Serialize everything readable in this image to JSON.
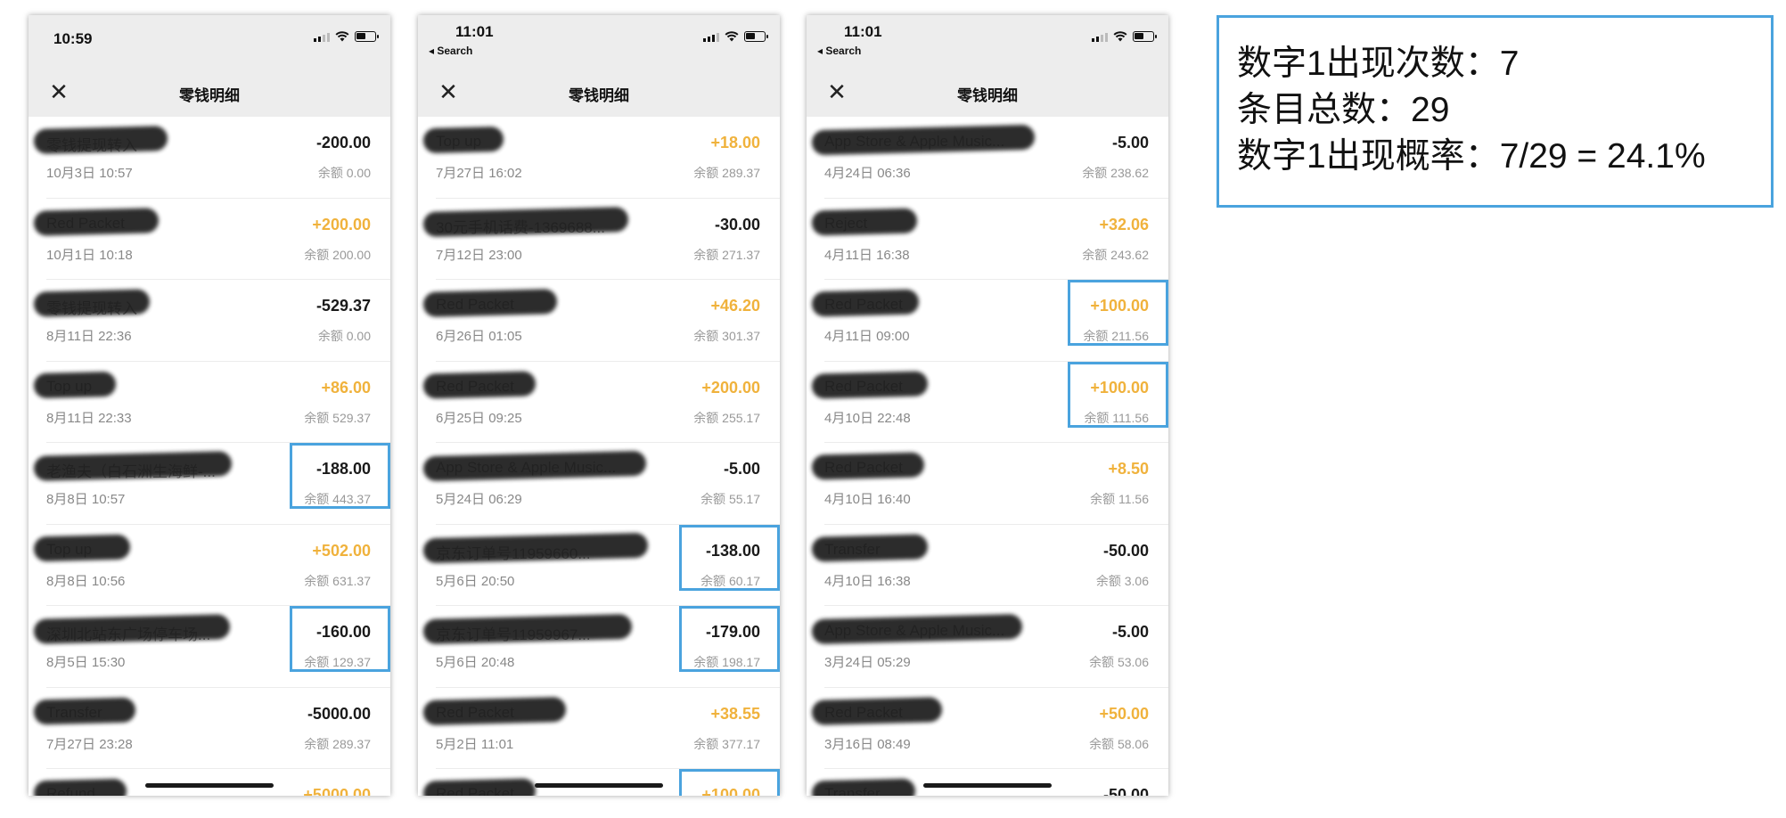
{
  "phones": [
    {
      "time": "10:59",
      "back_label": "",
      "title": "零钱明细",
      "rows": [
        {
          "title": "零钱提现转入",
          "date": "10月3日 10:57",
          "amount": "-200.00",
          "positive": false,
          "balance": "余额 0.00",
          "highlight": false
        },
        {
          "title": "Red Packet",
          "date": "10月1日 10:18",
          "amount": "+200.00",
          "positive": true,
          "balance": "余额 200.00",
          "highlight": false
        },
        {
          "title": "零钱提现转入",
          "date": "8月11日 22:36",
          "amount": "-529.37",
          "positive": false,
          "balance": "余额 0.00",
          "highlight": false
        },
        {
          "title": "Top up",
          "date": "8月11日 22:33",
          "amount": "+86.00",
          "positive": true,
          "balance": "余额 529.37",
          "highlight": false
        },
        {
          "title": "老渔夫（白石洲生海鲜-...",
          "date": "8月8日 10:57",
          "amount": "-188.00",
          "positive": false,
          "balance": "余额 443.37",
          "highlight": true
        },
        {
          "title": "Top up",
          "date": "8月8日 10:56",
          "amount": "+502.00",
          "positive": true,
          "balance": "余额 631.37",
          "highlight": false
        },
        {
          "title": "深圳北站东广场停车场...",
          "date": "8月5日 15:30",
          "amount": "-160.00",
          "positive": false,
          "balance": "余额 129.37",
          "highlight": true
        },
        {
          "title": "Transfer",
          "date": "7月27日 23:28",
          "amount": "-5000.00",
          "positive": false,
          "balance": "余额 289.37",
          "highlight": false
        },
        {
          "title": "Refund",
          "date": "",
          "amount": "+5000.00",
          "positive": true,
          "balance": "",
          "highlight": false
        }
      ]
    },
    {
      "time": "11:01",
      "back_label": "◂ Search",
      "title": "零钱明细",
      "rows": [
        {
          "title": "Top up",
          "date": "7月27日 16:02",
          "amount": "+18.00",
          "positive": true,
          "balance": "余额 289.37",
          "highlight": false
        },
        {
          "title": "30元手机话费-1369688...",
          "date": "7月12日 23:00",
          "amount": "-30.00",
          "positive": false,
          "balance": "余额 271.37",
          "highlight": false
        },
        {
          "title": "Red Packet",
          "date": "6月26日 01:05",
          "amount": "+46.20",
          "positive": true,
          "balance": "余额 301.37",
          "highlight": false
        },
        {
          "title": "Red Packet",
          "date": "6月25日 09:25",
          "amount": "+200.00",
          "positive": true,
          "balance": "余额 255.17",
          "highlight": false
        },
        {
          "title": "App Store & Apple Music...",
          "date": "5月24日 06:29",
          "amount": "-5.00",
          "positive": false,
          "balance": "余额 55.17",
          "highlight": false
        },
        {
          "title": "京东订单号11959660...",
          "date": "5月6日 20:50",
          "amount": "-138.00",
          "positive": false,
          "balance": "余额 60.17",
          "highlight": true
        },
        {
          "title": "京东订单号11959967...",
          "date": "5月6日 20:48",
          "amount": "-179.00",
          "positive": false,
          "balance": "余额 198.17",
          "highlight": true
        },
        {
          "title": "Red Packet",
          "date": "5月2日 11:01",
          "amount": "+38.55",
          "positive": true,
          "balance": "余额 377.17",
          "highlight": false
        },
        {
          "title": "Red Packet",
          "date": "",
          "amount": "+100.00",
          "positive": true,
          "balance": "",
          "highlight": true
        }
      ]
    },
    {
      "time": "11:01",
      "back_label": "◂ Search",
      "title": "零钱明细",
      "rows": [
        {
          "title": "App Store & Apple Music...",
          "date": "4月24日 06:36",
          "amount": "-5.00",
          "positive": false,
          "balance": "余额 238.62",
          "highlight": false
        },
        {
          "title": "Reject",
          "date": "4月11日 16:38",
          "amount": "+32.06",
          "positive": true,
          "balance": "余额 243.62",
          "highlight": false
        },
        {
          "title": "Red Packet",
          "date": "4月11日 09:00",
          "amount": "+100.00",
          "positive": true,
          "balance": "余额 211.56",
          "highlight": true
        },
        {
          "title": "Red Packet",
          "date": "4月10日 22:48",
          "amount": "+100.00",
          "positive": true,
          "balance": "余额 111.56",
          "highlight": true
        },
        {
          "title": "Red Packet",
          "date": "4月10日 16:40",
          "amount": "+8.50",
          "positive": true,
          "balance": "余额 11.56",
          "highlight": false
        },
        {
          "title": "Transfer",
          "date": "4月10日 16:38",
          "amount": "-50.00",
          "positive": false,
          "balance": "余额 3.06",
          "highlight": false
        },
        {
          "title": "App Store & Apple Music...",
          "date": "3月24日 05:29",
          "amount": "-5.00",
          "positive": false,
          "balance": "余额 53.06",
          "highlight": false
        },
        {
          "title": "Red Packet",
          "date": "3月16日 08:49",
          "amount": "+50.00",
          "positive": true,
          "balance": "余额 58.06",
          "highlight": false
        },
        {
          "title": "Transfer",
          "date": "",
          "amount": "-50.00",
          "positive": false,
          "balance": "",
          "highlight": false
        }
      ]
    }
  ],
  "summary": {
    "line1": "数字1出现次数：7",
    "line2": "条目总数：29",
    "line3": "数字1出现概率：7/29 = 24.1%"
  },
  "colors": {
    "positive_amount": "#f0b23c",
    "highlight_border": "#4aa3de",
    "nav_background": "#ededed"
  }
}
